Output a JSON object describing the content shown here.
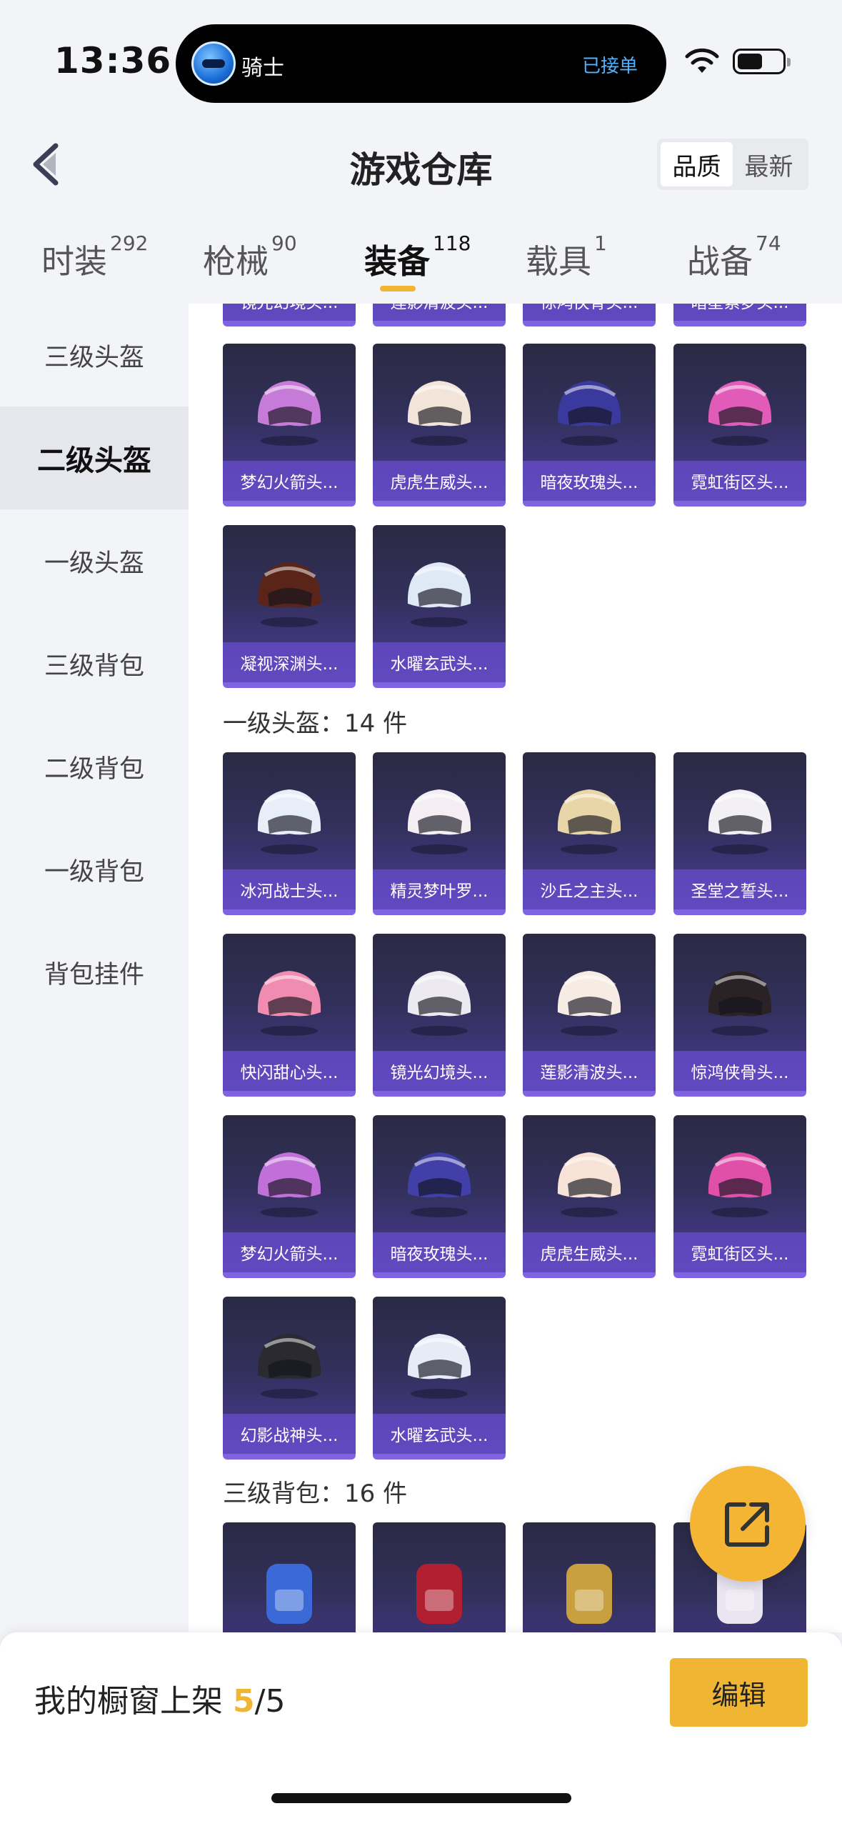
{
  "status": {
    "time": "13:36",
    "island_name": "骑士",
    "island_status": "已接单"
  },
  "header": {
    "title": "游戏仓库",
    "sort_options": [
      "品质",
      "最新"
    ]
  },
  "tabs": [
    {
      "label": "时装",
      "count": "292"
    },
    {
      "label": "枪械",
      "count": "90"
    },
    {
      "label": "装备",
      "count": "118"
    },
    {
      "label": "载具",
      "count": "1"
    },
    {
      "label": "战备",
      "count": "74"
    }
  ],
  "sidebar": {
    "items": [
      "三级头盔",
      "二级头盔",
      "一级头盔",
      "三级背包",
      "二级背包",
      "一级背包",
      "背包挂件"
    ]
  },
  "content": {
    "top_partial": [
      "镜光幻境头...",
      "莲影清波头...",
      "惊鸿侠骨头...",
      "暗星索梦头..."
    ],
    "level2_items": [
      "梦幻火箭头...",
      "虎虎生威头...",
      "暗夜玫瑰头...",
      "霓虹街区头...",
      "凝视深渊头...",
      "水曜玄武头..."
    ],
    "level1_title": "一级头盔：14 件",
    "level1_items": [
      "冰河战士头...",
      "精灵梦叶罗...",
      "沙丘之主头...",
      "圣堂之誓头...",
      "快闪甜心头...",
      "镜光幻境头...",
      "莲影清波头...",
      "惊鸿侠骨头...",
      "梦幻火箭头...",
      "暗夜玫瑰头...",
      "虎虎生威头...",
      "霓虹街区头...",
      "幻影战神头...",
      "水曜玄武头..."
    ],
    "bag3_title": "三级背包：16 件"
  },
  "bottom": {
    "shelf_label": "我的橱窗上架 ",
    "shelf_count": "5",
    "shelf_total": "/5",
    "edit_label": "编辑"
  },
  "colors": {
    "accent": "#f1b534",
    "card_border": "#7f63e0"
  }
}
